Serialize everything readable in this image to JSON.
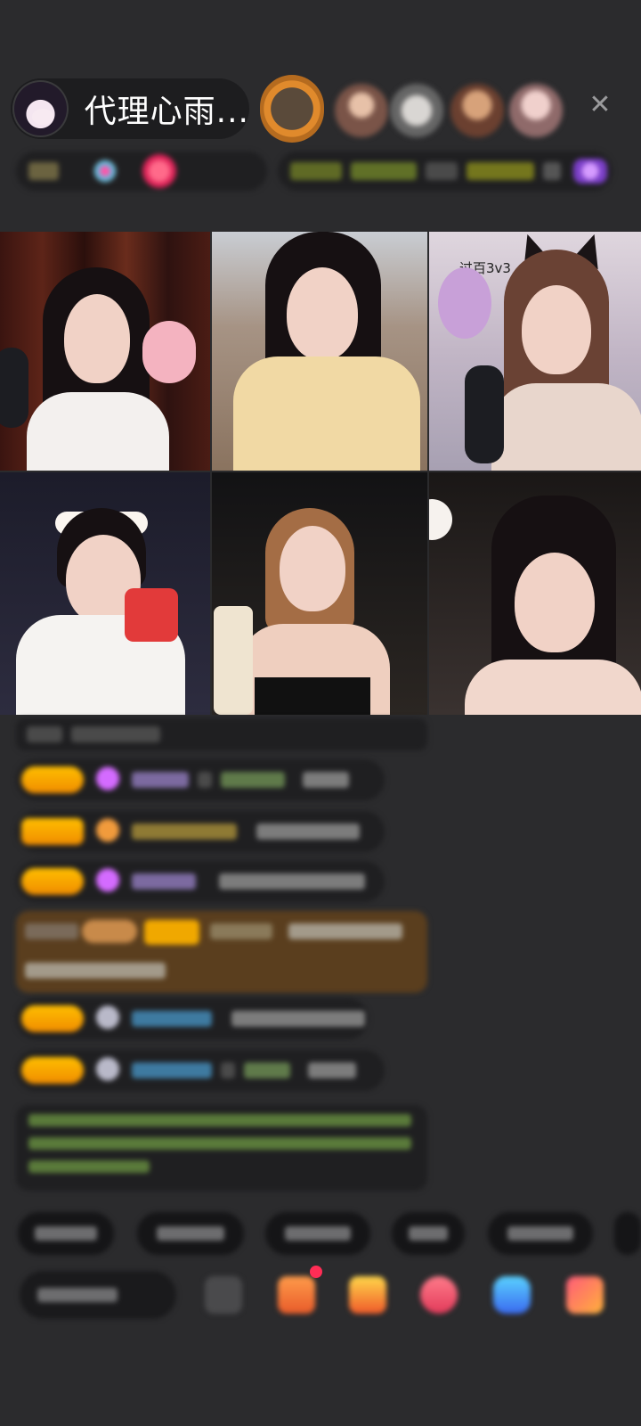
{
  "host": {
    "name": "代理心雨...",
    "avatar_icon": "host-avatar-icon"
  },
  "header": {
    "close_icon": "close-icon",
    "close_glyph": "✕"
  },
  "video_grid": {
    "cells": [
      {
        "label": ""
      },
      {
        "label": ""
      },
      {
        "label": "过百3v3"
      },
      {
        "label": ""
      },
      {
        "label": ""
      },
      {
        "label": ""
      }
    ]
  },
  "colors": {
    "background": "#2b2b2d",
    "badge_gold": "#f0a800",
    "gem_purple": "#d46bff",
    "promo_brown": "#5a3e1e"
  }
}
